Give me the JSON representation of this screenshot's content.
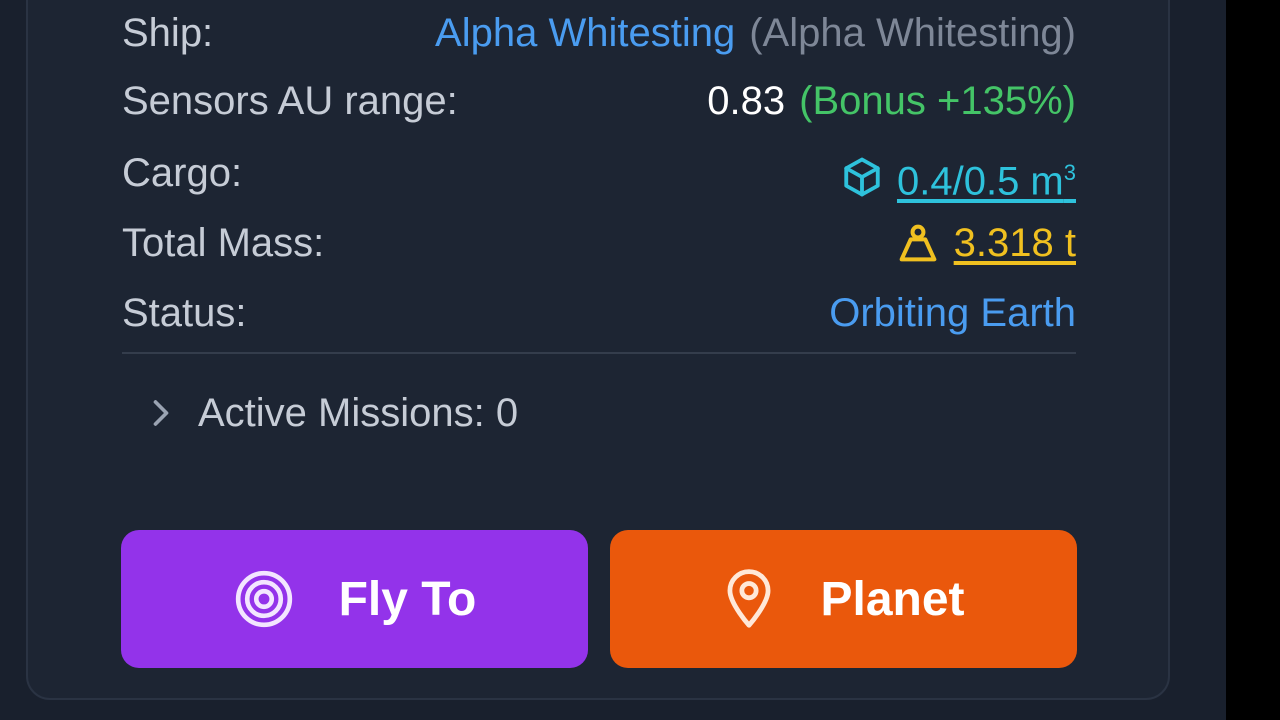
{
  "details": {
    "ship": {
      "label": "Ship:",
      "name": "Alpha Whitesting",
      "alt": "(Alpha Whitesting)"
    },
    "sensors": {
      "label": "Sensors AU range:",
      "value": "0.83",
      "bonus": "(Bonus +135%)"
    },
    "cargo": {
      "label": "Cargo:",
      "value": "0.4/0.5 m",
      "unit_sup": "3",
      "icon": "cube-icon"
    },
    "mass": {
      "label": "Total Mass:",
      "value": "3.318 t",
      "icon": "weight-icon"
    },
    "status": {
      "label": "Status:",
      "value": "Orbiting Earth"
    }
  },
  "missions": {
    "label": "Active Missions: 0",
    "icon": "chevron-right-icon"
  },
  "actions": {
    "fly_to": {
      "label": "Fly To",
      "icon": "target-icon",
      "color": "#9333ea"
    },
    "planet": {
      "label": "Planet",
      "icon": "map-pin-icon",
      "color": "#ea580c"
    }
  },
  "colors": {
    "link_blue": "#4a9cf0",
    "bonus_green": "#44c467",
    "cargo_cyan": "#2ec2dc",
    "mass_yellow": "#f0c020",
    "card_bg": "#1d2533"
  }
}
